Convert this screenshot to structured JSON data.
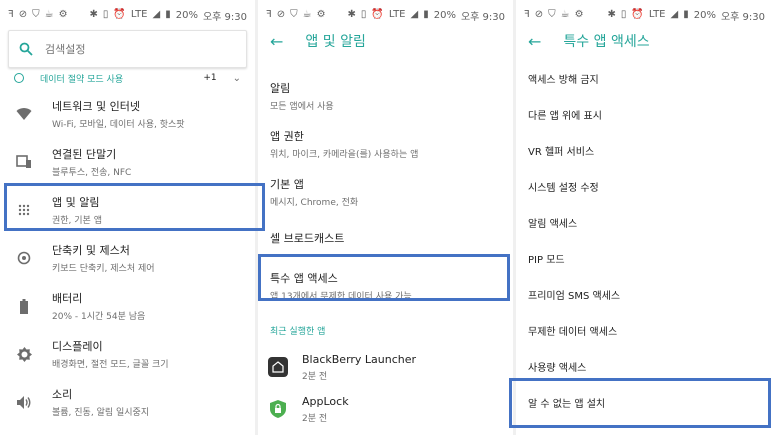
{
  "status": {
    "battery": "20%",
    "time": "오후 9:30",
    "network": "LTE"
  },
  "panel1": {
    "search_placeholder": "검색설정",
    "suggestion": {
      "label": "데이터 절약 모드 사용",
      "count": "+1"
    },
    "items": [
      {
        "title": "네트워크 및 인터넷",
        "sub": "Wi-Fi, 모바일, 데이터 사용, 핫스팟",
        "icon": "wifi-icon"
      },
      {
        "title": "연결된 단말기",
        "sub": "블루투스, 전송, NFC",
        "icon": "devices-icon"
      },
      {
        "title": "앱 및 알림",
        "sub": "권한, 기본 앱",
        "icon": "apps-grid-icon"
      },
      {
        "title": "단축키 및 제스처",
        "sub": "키보드 단축키, 제스처 제어",
        "icon": "gesture-icon"
      },
      {
        "title": "배터리",
        "sub": "20% - 1시간 54분 남음",
        "icon": "battery-icon"
      },
      {
        "title": "디스플레이",
        "sub": "배경화면, 절전 모드, 글꼴 크기",
        "icon": "brightness-icon"
      },
      {
        "title": "소리",
        "sub": "볼륨, 진동, 알림 일시중지",
        "icon": "volume-icon"
      }
    ]
  },
  "panel2": {
    "title": "앱 및 알림",
    "items": [
      {
        "title": "알림",
        "sub": "모든 앱에서 사용"
      },
      {
        "title": "앱 권한",
        "sub": "위치, 마이크, 카메라을(를) 사용하는 앱"
      },
      {
        "title": "기본 앱",
        "sub": "메시지, Chrome, 전화"
      },
      {
        "title": "셀 브로드캐스트",
        "sub": ""
      },
      {
        "title": "특수 앱 액세스",
        "sub": "앱 13개에서 무제한 데이터 사용 가능"
      }
    ],
    "recent_header": "최근 실행한 앱",
    "recent": [
      {
        "name": "BlackBerry Launcher",
        "time": "2분 전"
      },
      {
        "name": "AppLock",
        "time": "2분 전"
      }
    ]
  },
  "panel3": {
    "title": "특수 앱 액세스",
    "items": [
      "액세스 방해 금지",
      "다른 앱 위에 표시",
      "VR 헬퍼 서비스",
      "시스템 설정 수정",
      "알림 액세스",
      "PIP 모드",
      "프리미엄 SMS 액세스",
      "무제한 데이터 액세스",
      "사용량 액세스",
      "알 수 없는 앱 설치"
    ]
  },
  "colors": {
    "accent": "#26a69a",
    "highlight": "#4472c4"
  }
}
